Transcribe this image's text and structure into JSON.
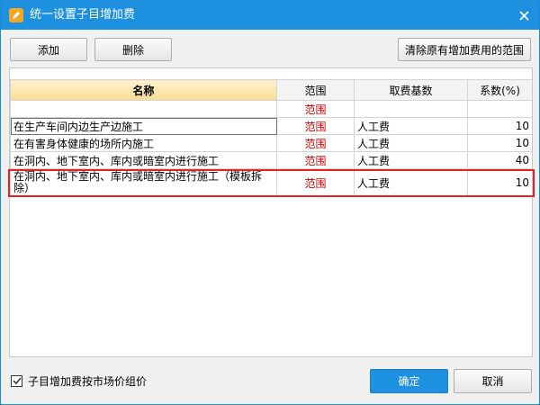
{
  "window": {
    "title": "统一设置子目增加费",
    "app_icon": "pencil-app-icon",
    "close_icon": "close-icon"
  },
  "toolbar": {
    "add_label": "添加",
    "delete_label": "删除",
    "clear_label": "清除原有增加费用的范围"
  },
  "table": {
    "headers": [
      "名称",
      "范围",
      "取费基数",
      "系数(%)"
    ],
    "rows": [
      {
        "name": "",
        "range": "范围",
        "base": "",
        "coef": ""
      },
      {
        "name": "在生产车间内边生产边施工",
        "range": "范围",
        "base": "人工费",
        "coef": "10"
      },
      {
        "name": "在有害身体健康的场所内施工",
        "range": "范围",
        "base": "人工费",
        "coef": "10"
      },
      {
        "name": "在洞内、地下室内、库内或暗室内进行施工",
        "range": "范围",
        "base": "人工费",
        "coef": "40"
      },
      {
        "name": "在洞内、地下室内、库内或暗室内进行施工（模板拆除）",
        "range": "范围",
        "base": "人工费",
        "coef": "10"
      }
    ],
    "highlight_color": "#e8202a",
    "range_color": "#d40000"
  },
  "footer": {
    "market_price_checkbox_label": "子目增加费按市场价组价",
    "market_price_checked": true,
    "ok_label": "确定",
    "cancel_label": "取消"
  },
  "colors": {
    "title_bar": "#1d90e0",
    "header_highlight": "#f8dc95",
    "ok_button": "#1d90e0"
  }
}
